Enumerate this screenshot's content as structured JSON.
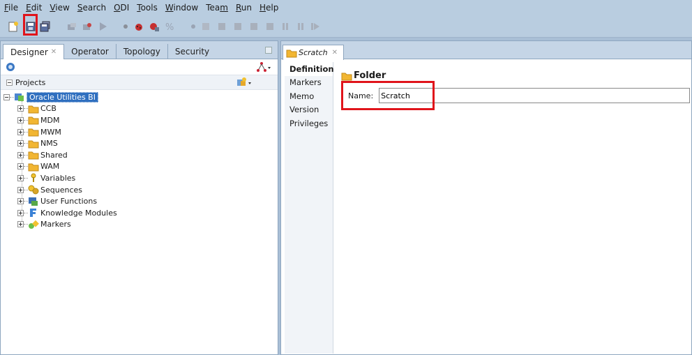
{
  "menu": [
    {
      "label": "File",
      "key": "F"
    },
    {
      "label": "Edit",
      "key": "E"
    },
    {
      "label": "View",
      "key": "V"
    },
    {
      "label": "Search",
      "key": "S"
    },
    {
      "label": "ODI",
      "key": "O"
    },
    {
      "label": "Tools",
      "key": "T"
    },
    {
      "label": "Window",
      "key": "W"
    },
    {
      "label": "Team",
      "key": "m"
    },
    {
      "label": "Run",
      "key": "R"
    },
    {
      "label": "Help",
      "key": "H"
    }
  ],
  "toolbar": {
    "icons": [
      "new-icon",
      "save-icon",
      "save-all-icon",
      "refresh-icon",
      "debug-icon",
      "run-icon",
      "breakpoint-icon",
      "bug-icon",
      "debug-session-icon",
      "percent-icon",
      "step-icon",
      "step-into-icon",
      "step-over-icon",
      "step-out-icon",
      "step-return-icon",
      "resume-icon",
      "pause-icon",
      "continue-icon"
    ]
  },
  "navigator": {
    "tabs": [
      "Designer",
      "Operator",
      "Topology",
      "Security"
    ],
    "active_tab": "Designer",
    "section": "Projects",
    "tree": {
      "root": "Oracle Utilities BI",
      "children": [
        {
          "label": "CCB",
          "icon": "folder-icon"
        },
        {
          "label": "MDM",
          "icon": "folder-icon"
        },
        {
          "label": "MWM",
          "icon": "folder-icon"
        },
        {
          "label": "NMS",
          "icon": "folder-icon"
        },
        {
          "label": "Shared",
          "icon": "folder-icon"
        },
        {
          "label": "WAM",
          "icon": "folder-icon"
        },
        {
          "label": "Variables",
          "icon": "variable-icon"
        },
        {
          "label": "Sequences",
          "icon": "sequence-icon"
        },
        {
          "label": "User Functions",
          "icon": "user-function-icon"
        },
        {
          "label": "Knowledge Modules",
          "icon": "knowledge-module-icon"
        },
        {
          "label": "Markers",
          "icon": "marker-icon"
        }
      ]
    }
  },
  "editor": {
    "tab_title": "Scratch",
    "side_tabs": [
      "Definition",
      "Markers",
      "Memo",
      "Version",
      "Privileges"
    ],
    "active_side_tab": "Definition",
    "section_title": "Folder",
    "name_label": "Name:",
    "name_value": "Scratch"
  },
  "colors": {
    "highlight": "#e0141b",
    "selection": "#2f6fbf",
    "folder": "#f2b632"
  }
}
